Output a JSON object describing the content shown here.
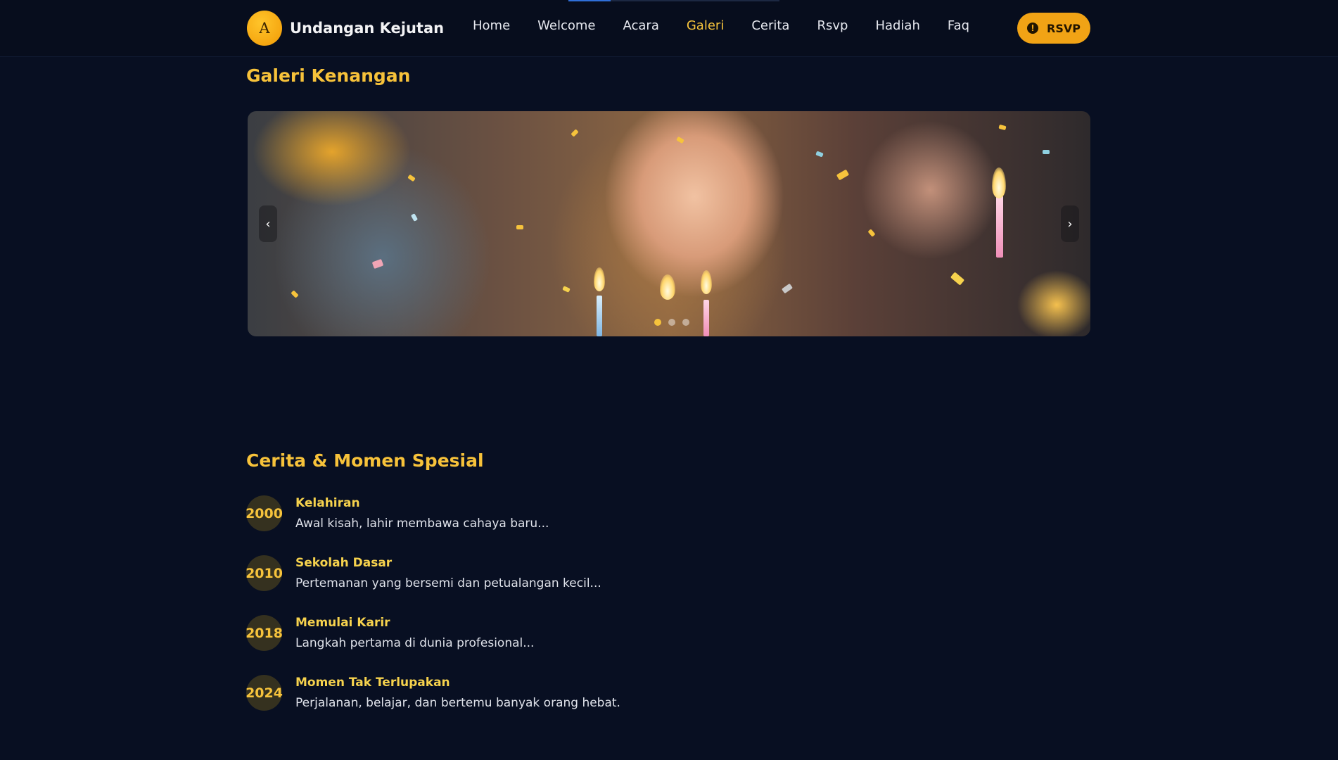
{
  "header": {
    "logo_letter": "A",
    "brand": "Undangan Kejutan",
    "nav": [
      {
        "label": "Home"
      },
      {
        "label": "Welcome"
      },
      {
        "label": "Acara"
      },
      {
        "label": "Galeri",
        "active": true
      },
      {
        "label": "Cerita"
      },
      {
        "label": "Rsvp"
      },
      {
        "label": "Hadiah"
      },
      {
        "label": "Faq"
      }
    ],
    "rsvp_button": {
      "label": "RSVP",
      "icon": "alert-circle-icon",
      "icon_glyph": "!"
    }
  },
  "gallery": {
    "title": "Galeri Kenangan",
    "prev_label": "‹",
    "next_label": "›",
    "slide_count": 3,
    "active_slide": 1
  },
  "story": {
    "title": "Cerita & Momen Spesial",
    "items": [
      {
        "year": "2000",
        "title": "Kelahiran",
        "desc": "Awal kisah, lahir membawa cahaya baru..."
      },
      {
        "year": "2010",
        "title": "Sekolah Dasar",
        "desc": "Pertemanan yang bersemi dan petualangan kecil..."
      },
      {
        "year": "2018",
        "title": "Memulai Karir",
        "desc": "Langkah pertama di dunia profesional..."
      },
      {
        "year": "2024",
        "title": "Momen Tak Terlupakan",
        "desc": "Perjalanan, belajar, dan bertemu banyak orang hebat."
      }
    ]
  },
  "colors": {
    "accent": "#f6c33c",
    "button": "#f1a315",
    "background": "#080f22"
  }
}
